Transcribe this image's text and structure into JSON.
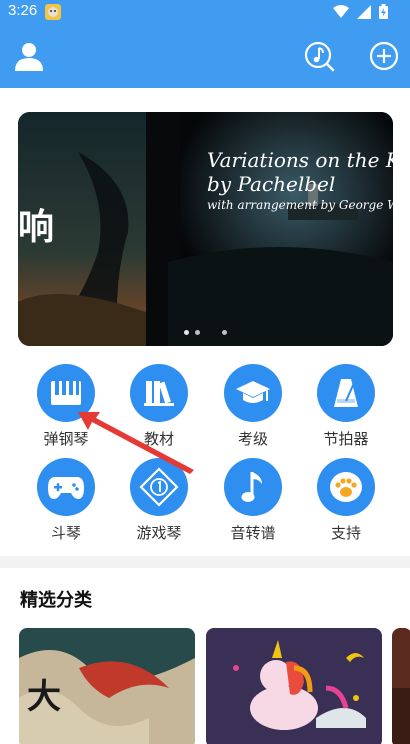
{
  "status_bar": {
    "time": "3:26",
    "icons": [
      "app-badge-icon",
      "wifi-icon",
      "signal-icon",
      "battery-icon"
    ]
  },
  "app_bar": {
    "icons": [
      "user-icon",
      "tuner-icon",
      "plus-icon"
    ]
  },
  "banner": {
    "left_text": "响",
    "title_line1": "Variations on the Kan",
    "title_line2": "by Pachelbel",
    "subtitle": "with arrangement by George Win"
  },
  "features": [
    {
      "label": "弹钢琴",
      "icon": "piano-keys-icon"
    },
    {
      "label": "教材",
      "icon": "books-icon"
    },
    {
      "label": "考级",
      "icon": "graduation-cap-icon"
    },
    {
      "label": "节拍器",
      "icon": "metronome-icon"
    },
    {
      "label": "斗琴",
      "icon": "gamepad-icon"
    },
    {
      "label": "游戏琴",
      "icon": "diamond-game-icon"
    },
    {
      "label": "音转谱",
      "icon": "music-note-icon"
    },
    {
      "label": "支持",
      "icon": "paw-icon"
    }
  ],
  "featured": {
    "title": "精选分类"
  },
  "colors": {
    "primary": "#3f9cf0",
    "icon_bg": "#2f8ff0",
    "arrow": "#e53935"
  }
}
